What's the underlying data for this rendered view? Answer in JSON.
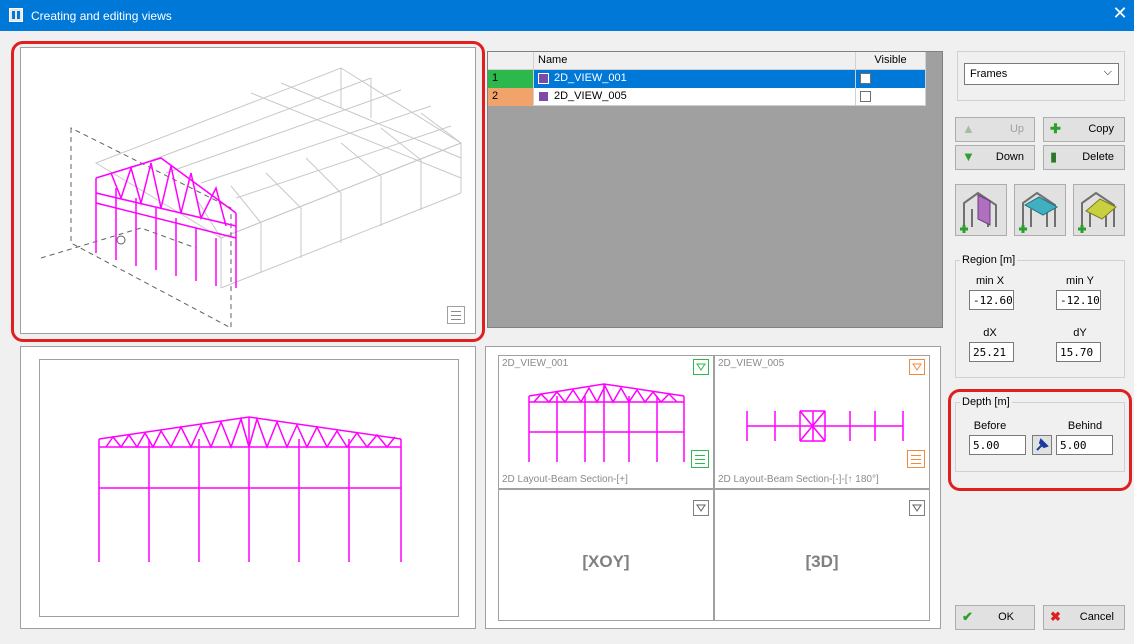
{
  "window": {
    "title": "Creating and editing views",
    "close_glyph": "✕"
  },
  "views_table": {
    "columns": [
      "Name",
      "Visible"
    ],
    "rows": [
      {
        "index": "1",
        "name": "2D_VIEW_001",
        "selected": true,
        "index_color": "#2db84d"
      },
      {
        "index": "2",
        "name": "2D_VIEW_005",
        "selected": false,
        "index_color": "#f2a36b"
      }
    ]
  },
  "type_select": {
    "value": "Frames",
    "arrow": "⌵"
  },
  "buttons": {
    "up": "Up",
    "down": "Down",
    "copy": "Copy",
    "delete": "Delete",
    "ok": "OK",
    "cancel": "Cancel"
  },
  "region": {
    "title": "Region [m]",
    "min_x_label": "min X",
    "min_x": "-12.60",
    "min_y_label": "min Y",
    "min_y": "-12.10",
    "dx_label": "dX",
    "dx": "25.21",
    "dy_label": "dY",
    "dy": "15.70"
  },
  "depth": {
    "title": "Depth [m]",
    "before_label": "Before",
    "before": "5.00",
    "behind_label": "Behind",
    "behind": "5.00"
  },
  "tiles": [
    {
      "name": "2D_VIEW_001",
      "desc": "2D Layout-Beam Section-[+]",
      "accent": "#2db84d"
    },
    {
      "name": "2D_VIEW_005",
      "desc": "2D Layout-Beam Section-[-]-[↑ 180°]",
      "accent": "#f08a3c"
    },
    {
      "label": "[XOY]"
    },
    {
      "label": "[3D]"
    }
  ],
  "colors": {
    "accent": "#0078d7",
    "highlight": "#e02020",
    "frame": "#ff00ff"
  }
}
